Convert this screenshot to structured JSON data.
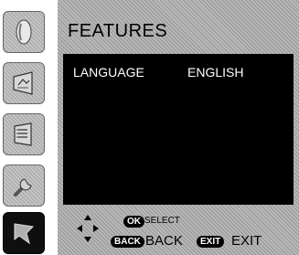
{
  "panel": {
    "title": "FEATURES",
    "menu": [
      {
        "label": "LANGUAGE",
        "value": "ENGLISH"
      }
    ]
  },
  "sidebar": {
    "items": [
      {
        "icon": "color-drop-icon",
        "active": false
      },
      {
        "icon": "screen-image-icon",
        "active": false
      },
      {
        "icon": "list-document-icon",
        "active": false
      },
      {
        "icon": "wrench-tool-icon",
        "active": false
      },
      {
        "icon": "features-flag-icon",
        "active": true
      }
    ]
  },
  "footer": {
    "ok_key": "OK",
    "select_label": "SELECT",
    "back_key": "BACK",
    "back_label": "BACK",
    "exit_key": "EXIT",
    "exit_label": "EXIT"
  }
}
